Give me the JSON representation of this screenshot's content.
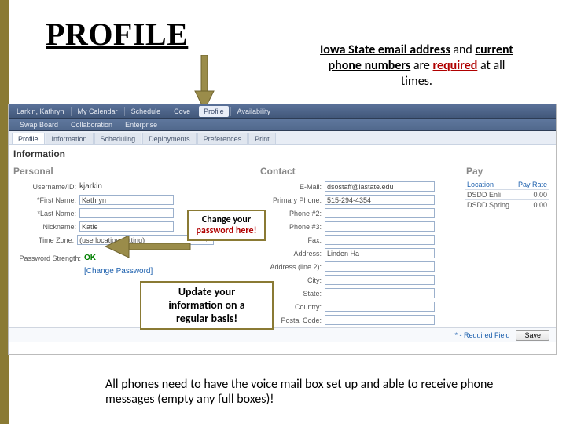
{
  "heading": "PROFILE",
  "requirement_note": {
    "part1": "Iowa State email address",
    "part2": "and",
    "part3": "current phone numbers",
    "part4": "are",
    "part5": "required",
    "part6": "at all times."
  },
  "topbar": {
    "items": [
      {
        "label": "Larkin, Kathryn"
      },
      {
        "label": "My Calendar"
      },
      {
        "label": "Schedule"
      },
      {
        "label": "Cove"
      },
      {
        "label": "Profile"
      },
      {
        "label": "Availability"
      }
    ],
    "active_index": 4
  },
  "secondary": {
    "items": [
      {
        "label": "Swap Board"
      },
      {
        "label": "Collaboration"
      },
      {
        "label": "Enterprise"
      }
    ]
  },
  "tabs": {
    "items": [
      {
        "label": "Profile"
      },
      {
        "label": "Information"
      },
      {
        "label": "Scheduling"
      },
      {
        "label": "Deployments"
      },
      {
        "label": "Preferences"
      },
      {
        "label": "Print"
      }
    ],
    "active_index": 0
  },
  "section_title": "Information",
  "personal": {
    "title": "Personal",
    "username_label": "Username/ID:",
    "username": "kjarkin",
    "first_label": "*First Name:",
    "first": "Kathryn",
    "last_label": "*Last Name:",
    "last": "",
    "nick_label": "Nickname:",
    "nick": "Katie",
    "tz_label": "Time Zone:",
    "tz": "(use location setting)",
    "pwd_label": "Password Strength:",
    "pwd_status": "OK",
    "change_pw": "[Change Password]"
  },
  "contact": {
    "title": "Contact",
    "email_label": "E-Mail:",
    "email": "dsostaff@iastate.edu",
    "pphone_label": "Primary Phone:",
    "pphone": "515-294-4354",
    "p2_label": "Phone #2:",
    "p3_label": "Phone #3:",
    "fax_label": "Fax:",
    "addr_label": "Address:",
    "addr": "Linden Ha",
    "addr2_label": "Address (line 2):",
    "city_label": "City:",
    "state_label": "State:",
    "country_label": "Country:",
    "postal_label": "Postal Code:"
  },
  "pay": {
    "title": "Pay",
    "col1": "Location",
    "col2": "Pay Rate",
    "rows": [
      {
        "loc": "DSDD Enli",
        "rate": "0.00"
      },
      {
        "loc": "DSDD Spring",
        "rate": "0.00"
      }
    ]
  },
  "footer": {
    "req": "* - Required Field",
    "save": "Save"
  },
  "callouts": {
    "pw_line1": "Change your",
    "pw_line2": "password here!",
    "upd_line1": "Update your",
    "upd_line2": "information on a",
    "upd_line3": "regular basis!"
  },
  "bottom_note": "All phones need to have the voice mail box set up and able to receive phone messages (empty any full boxes)!"
}
